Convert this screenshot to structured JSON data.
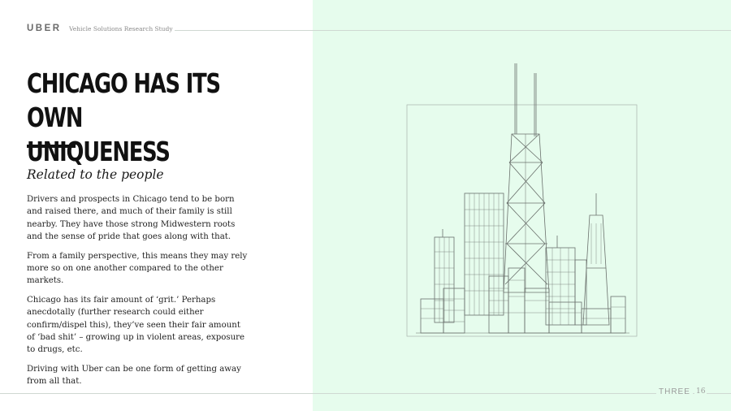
{
  "header": {
    "brand": "UBER",
    "subtitle": "Vehicle Solutions Research Study"
  },
  "slide": {
    "title_line1": "CHICAGO HAS ITS OWN",
    "title_line2": "UNIQUENESS",
    "subhead": "Related to the people",
    "paragraphs": [
      "Drivers and prospects in Chicago tend to be born and raised there, and much of their family is still nearby. They have those strong Midwestern roots and the sense of pride that goes along with that.",
      "From a family perspective, this means they may rely more so on one another compared to the other markets.",
      "Chicago has its fair amount of ‘grit.’ Perhaps anecdotally (further research could either confirm/dispel this), they’ve seen their fair amount of ‘bad shit’ – growing up in violent areas, exposure to drugs, etc.",
      "Driving with Uber can be one form of getting away from all that."
    ]
  },
  "illustration": {
    "subject": "chicago-skyline-sketch",
    "panel_color": "#e6fced",
    "line_color": "#6b716d"
  },
  "footer": {
    "logo": "THREE",
    "page_number": "16"
  }
}
